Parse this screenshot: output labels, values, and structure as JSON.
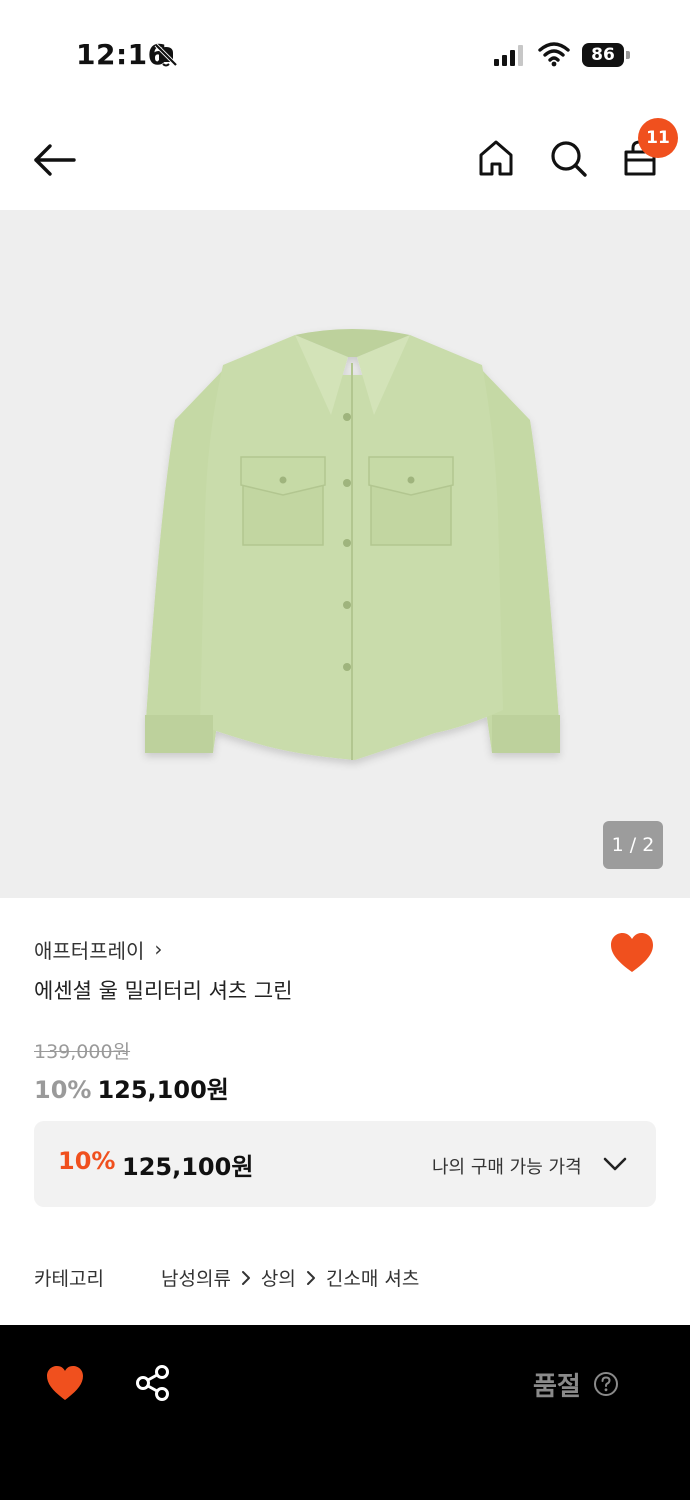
{
  "status_bar": {
    "time": "12:16",
    "battery": "86",
    "icons": [
      "bell-off-icon",
      "signal-icon",
      "wifi-icon",
      "battery-icon"
    ]
  },
  "nav": {
    "icons": [
      "back-arrow-icon",
      "home-icon",
      "search-icon",
      "shopping-bag-icon"
    ],
    "cart_count": "11"
  },
  "gallery": {
    "counter": "1 / 2",
    "background": "#eeeeee",
    "shirt_color": "#c4d8a4"
  },
  "product": {
    "brand": "애프터프레이",
    "brand_chevron": "›",
    "name": "에센셜 울 밀리터리 셔츠 그린",
    "original_price": "139,000원",
    "discount": "10%",
    "sale_price": "125,100원",
    "wishlisted": true
  },
  "my_price": {
    "discount": "10%",
    "price": "125,100원",
    "label": "나의 구매 가능 가격"
  },
  "category": {
    "label": "카테고리",
    "path": [
      "남성의류",
      "상의",
      "긴소매 셔츠"
    ]
  },
  "bottom_bar": {
    "status": "품절",
    "icons": [
      "heart-icon",
      "share-icon",
      "help-icon"
    ]
  },
  "colors": {
    "accent": "#f0501e",
    "muted": "#9a9a9a",
    "bottom_bar": "#000000"
  }
}
